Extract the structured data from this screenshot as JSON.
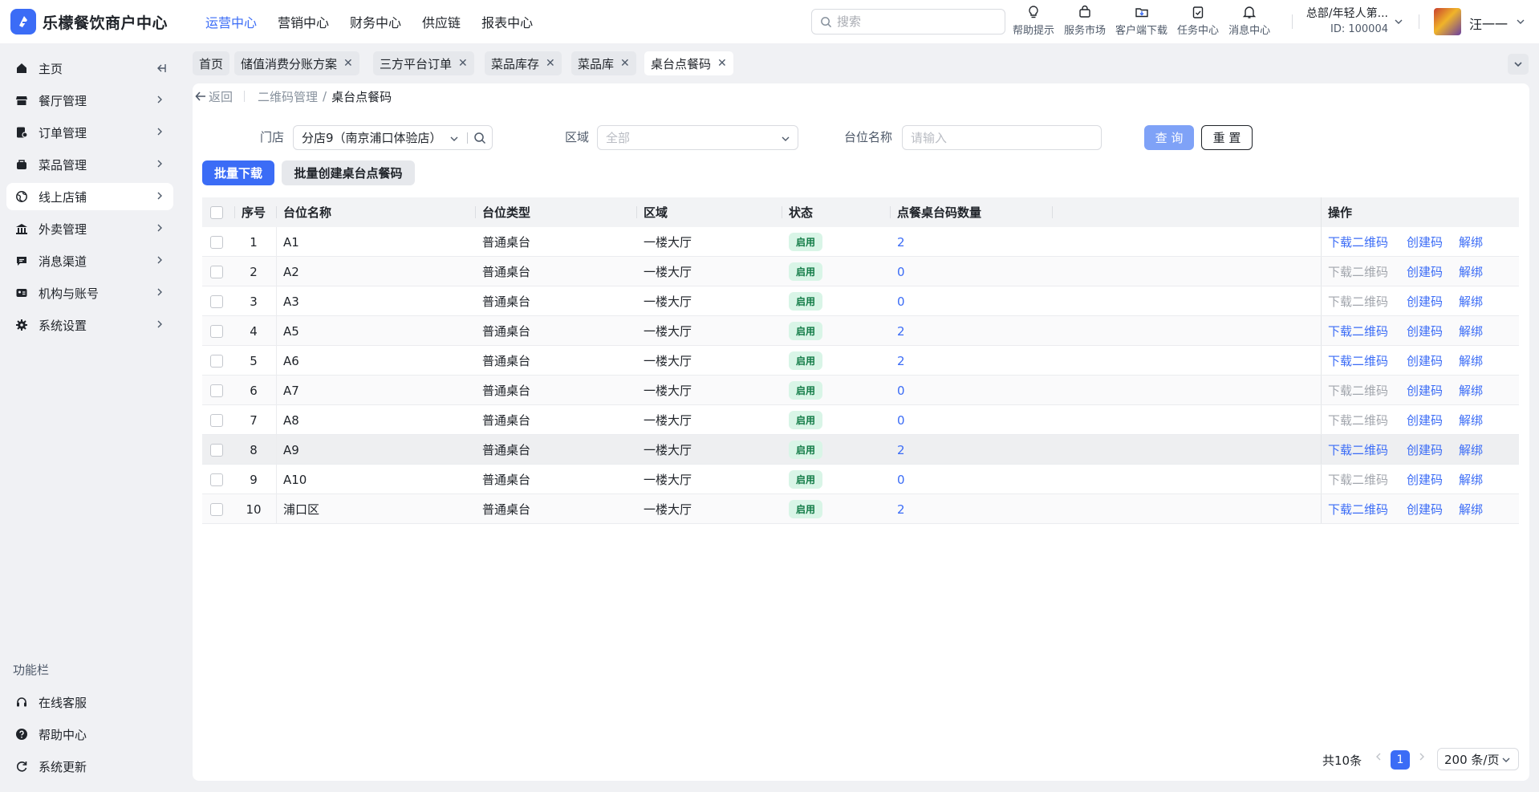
{
  "app": {
    "name": "乐檬餐饮商户中心"
  },
  "topnav": [
    {
      "label": "运营中心",
      "active": true
    },
    {
      "label": "营销中心"
    },
    {
      "label": "财务中心"
    },
    {
      "label": "供应链"
    },
    {
      "label": "报表中心"
    }
  ],
  "search": {
    "placeholder": "搜索"
  },
  "tools": [
    {
      "label": "帮助提示",
      "icon": "lightbulb-icon"
    },
    {
      "label": "服务市场",
      "icon": "shopping-bag-icon"
    },
    {
      "label": "客户端下载",
      "icon": "download-folder-icon"
    },
    {
      "label": "任务中心",
      "icon": "clipboard-check-icon"
    },
    {
      "label": "消息中心",
      "icon": "bell-icon"
    }
  ],
  "tenant": {
    "name": "总部/年轻人第...",
    "id": "ID: 100004"
  },
  "user": {
    "name": "汪一一"
  },
  "sidebar": {
    "items": [
      {
        "label": "主页",
        "icon": "home-icon"
      },
      {
        "label": "餐厅管理",
        "icon": "store-icon"
      },
      {
        "label": "订单管理",
        "icon": "order-icon"
      },
      {
        "label": "菜品管理",
        "icon": "dish-icon"
      },
      {
        "label": "线上店铺",
        "icon": "globe-icon",
        "active": true
      },
      {
        "label": "外卖管理",
        "icon": "bank-icon"
      },
      {
        "label": "消息渠道",
        "icon": "chat-icon"
      },
      {
        "label": "机构与账号",
        "icon": "id-card-icon"
      },
      {
        "label": "系统设置",
        "icon": "gear-icon"
      }
    ],
    "caption": "功能栏",
    "footer": [
      {
        "label": "在线客服",
        "icon": "headset-icon"
      },
      {
        "label": "帮助中心",
        "icon": "help-icon"
      },
      {
        "label": "系统更新",
        "icon": "refresh-icon"
      }
    ]
  },
  "tabs": [
    {
      "label": "首页"
    },
    {
      "label": "储值消费分账方案"
    },
    {
      "label": "三方平台订单"
    },
    {
      "label": "菜品库存"
    },
    {
      "label": "菜品库"
    },
    {
      "label": "桌台点餐码",
      "active": true
    }
  ],
  "breadcrumb": {
    "back": "返回",
    "parent": "二维码管理",
    "current": "桌台点餐码"
  },
  "filters": {
    "store_label": "门店",
    "store_value": "分店9（南京浦口体验店）",
    "area_label": "区域",
    "area_placeholder": "全部",
    "table_label": "台位名称",
    "table_placeholder": "请输入",
    "query": "查 询",
    "reset": "重 置"
  },
  "actions": {
    "batch_download": "批量下载",
    "batch_create": "批量创建桌台点餐码"
  },
  "table": {
    "columns": [
      "序号",
      "台位名称",
      "台位类型",
      "区域",
      "状态",
      "点餐桌台码数量",
      "操作"
    ],
    "ops": {
      "download": "下载二维码",
      "create": "创建码",
      "unbind": "解绑"
    },
    "rows": [
      {
        "no": "1",
        "name": "A1",
        "type": "普通桌台",
        "area": "一楼大厅",
        "status": "启用",
        "count": "2"
      },
      {
        "no": "2",
        "name": "A2",
        "type": "普通桌台",
        "area": "一楼大厅",
        "status": "启用",
        "count": "0"
      },
      {
        "no": "3",
        "name": "A3",
        "type": "普通桌台",
        "area": "一楼大厅",
        "status": "启用",
        "count": "0"
      },
      {
        "no": "4",
        "name": "A5",
        "type": "普通桌台",
        "area": "一楼大厅",
        "status": "启用",
        "count": "2"
      },
      {
        "no": "5",
        "name": "A6",
        "type": "普通桌台",
        "area": "一楼大厅",
        "status": "启用",
        "count": "2"
      },
      {
        "no": "6",
        "name": "A7",
        "type": "普通桌台",
        "area": "一楼大厅",
        "status": "启用",
        "count": "0"
      },
      {
        "no": "7",
        "name": "A8",
        "type": "普通桌台",
        "area": "一楼大厅",
        "status": "启用",
        "count": "0"
      },
      {
        "no": "8",
        "name": "A9",
        "type": "普通桌台",
        "area": "一楼大厅",
        "status": "启用",
        "count": "2"
      },
      {
        "no": "9",
        "name": "A10",
        "type": "普通桌台",
        "area": "一楼大厅",
        "status": "启用",
        "count": "0"
      },
      {
        "no": "10",
        "name": "浦口区",
        "type": "普通桌台",
        "area": "一楼大厅",
        "status": "启用",
        "count": "2"
      }
    ]
  },
  "pagination": {
    "total": "共10条",
    "current": "1",
    "page_size": "200 条/页"
  },
  "colors": {
    "accent": "#3b6cf6",
    "success_bg": "#d9f5e7",
    "success_text": "#107a45"
  }
}
